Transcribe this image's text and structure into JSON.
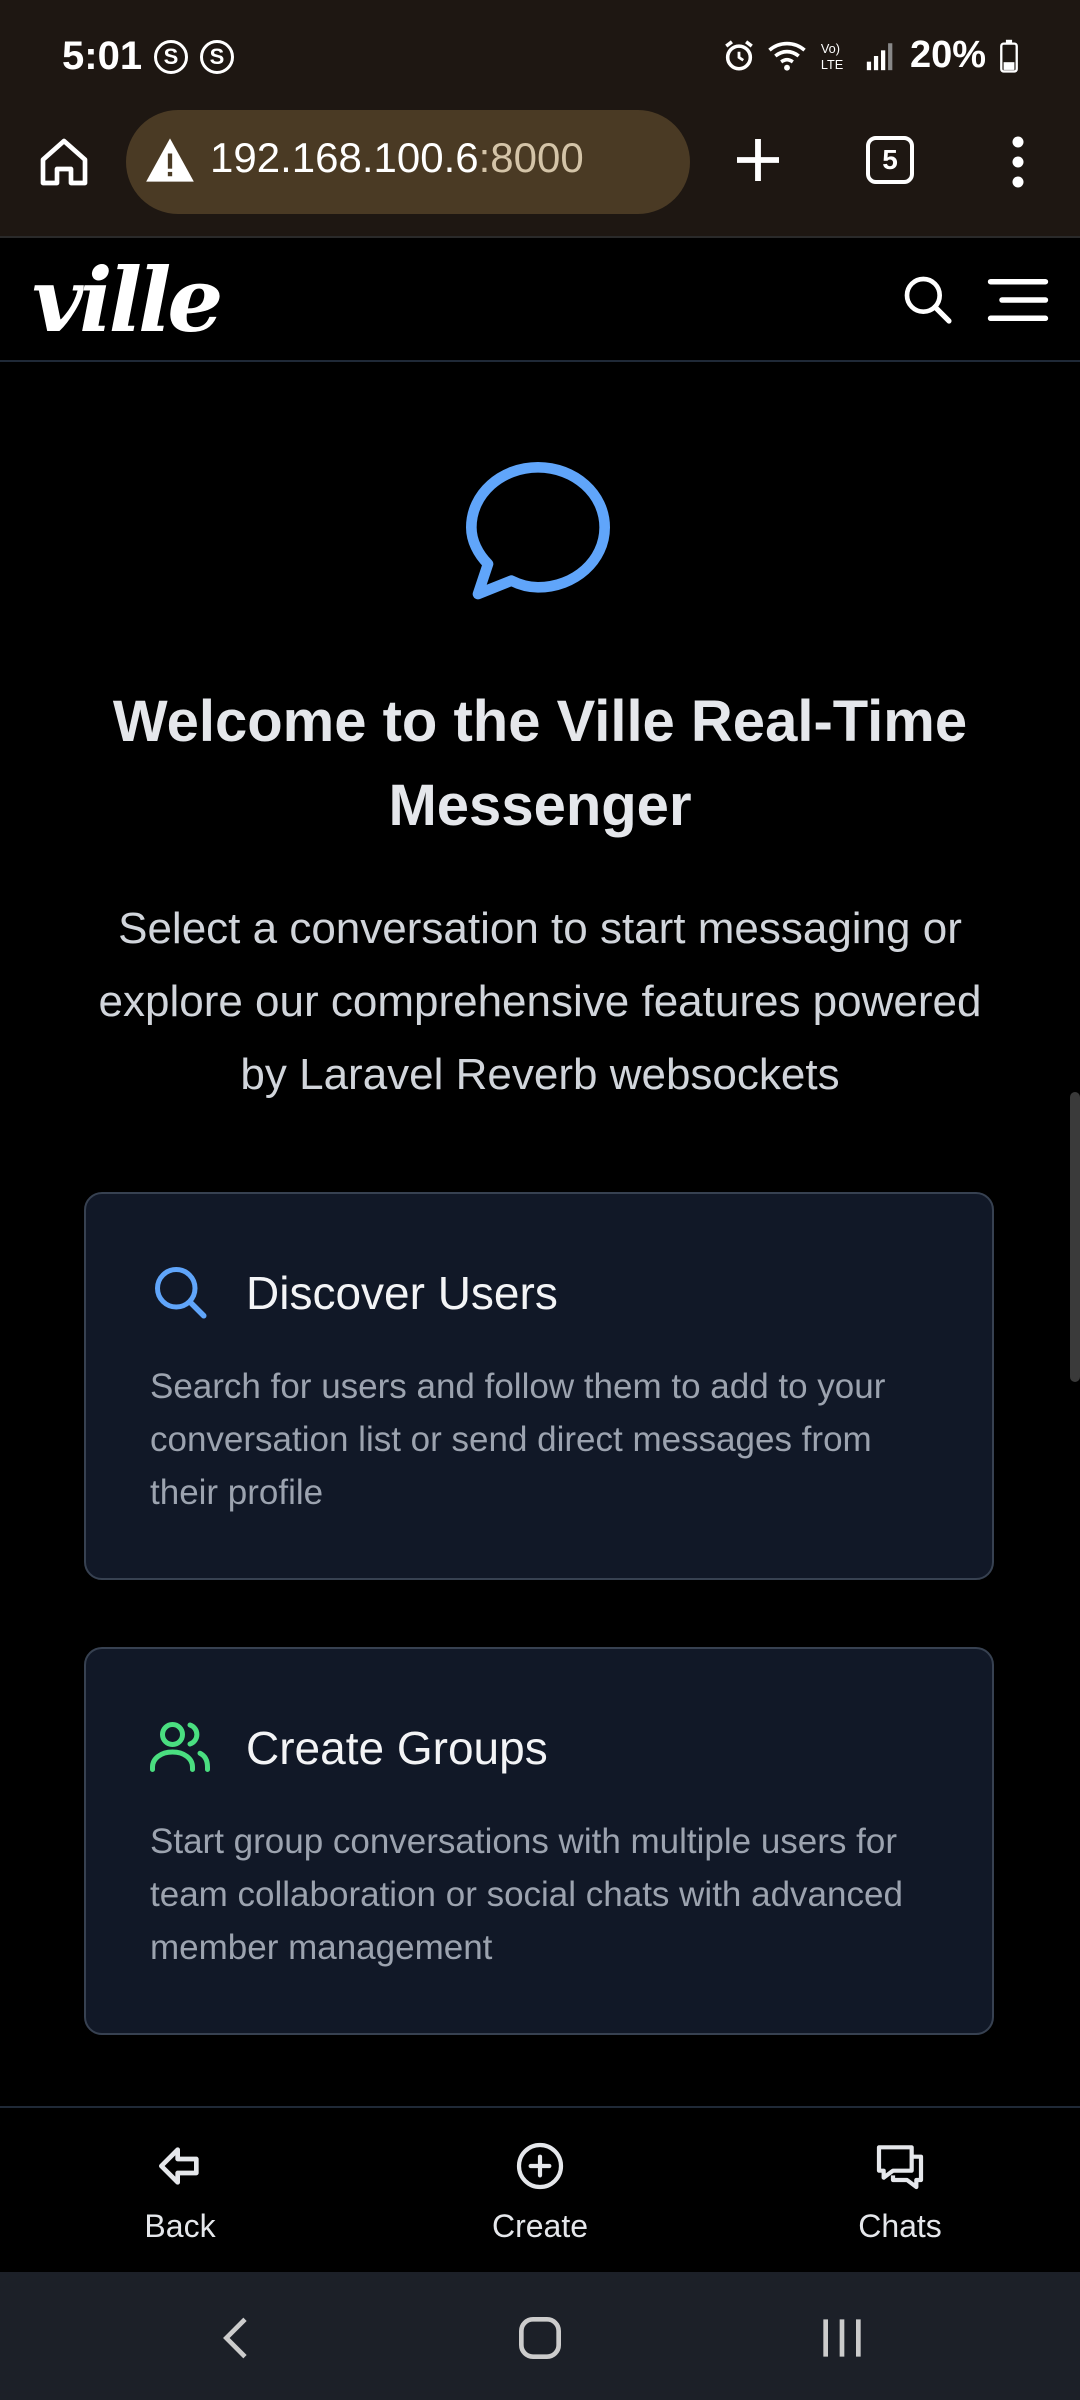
{
  "status_bar": {
    "time": "5:01",
    "badge_letter": "S",
    "battery": "20%",
    "icons": [
      "alarm-icon",
      "wifi-icon",
      "volte-icon",
      "signal-icon",
      "battery-icon"
    ]
  },
  "browser": {
    "url_host": "192.168.100.6",
    "url_port": ":8000",
    "tab_count": "5"
  },
  "app_header": {
    "logo": "ville"
  },
  "main": {
    "title": "Welcome to the Ville Real-Time Messenger",
    "subtitle": "Select a conversation to start messaging or explore our comprehensive features powered by Laravel Reverb websockets",
    "cards": [
      {
        "title": "Discover Users",
        "description": "Search for users and follow them to add to your conversation list or send direct messages from their profile",
        "icon": "search-icon",
        "icon_color": "#60a5fa"
      },
      {
        "title": "Create Groups",
        "description": "Start group conversations with multiple users for team collaboration or social chats with advanced member management",
        "icon": "users-icon",
        "icon_color": "#4ade80"
      }
    ]
  },
  "bottom_nav": {
    "back_label": "Back",
    "create_label": "Create",
    "chats_label": "Chats"
  },
  "colors": {
    "accent_blue": "#60a5fa",
    "accent_green": "#4ade80",
    "card_bg": "#111827",
    "browser_chrome": "#1e1712"
  }
}
